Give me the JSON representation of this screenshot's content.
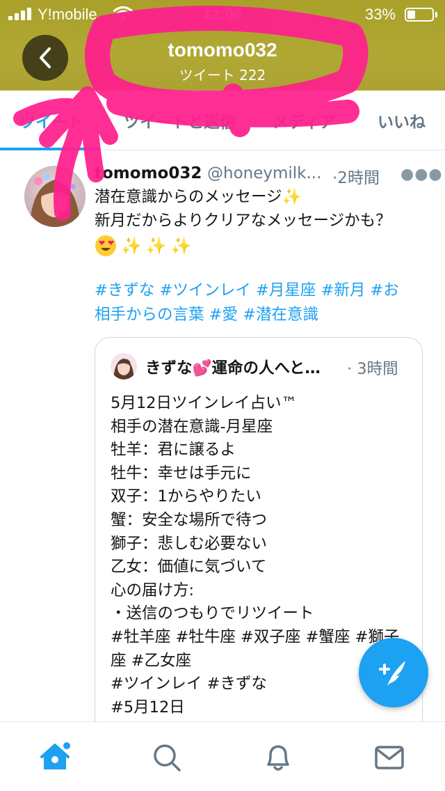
{
  "status_bar": {
    "carrier": "Y!mobile",
    "time": "12:06",
    "battery_percent": "33%",
    "battery_level": 0.33
  },
  "header": {
    "back_icon": "chevron-left-icon",
    "name": "tomomo032",
    "subtitle": "ツイート 222"
  },
  "tabs": [
    {
      "label": "ツイート",
      "active": true
    },
    {
      "label": "ツイートと返信",
      "active": false
    },
    {
      "label": "メディア",
      "active": false
    },
    {
      "label": "いいね",
      "active": false
    }
  ],
  "tweet": {
    "author_name": "tomomo032",
    "author_handle": "@honeymilk...",
    "time": "·2時間",
    "more_icon": "more-horizontal-icon",
    "text_lines": [
      "潜在意識からのメッセージ✨",
      "新月だからよりクリアなメッセージかも？"
    ],
    "emojis": [
      "😍",
      "✨",
      "✨",
      "✨"
    ],
    "hashtag_lines": [
      "#きずな #ツインレイ #月星座 #新月  #お",
      "相手からの言葉 #愛 #潜在意識"
    ]
  },
  "quoted_tweet": {
    "author_name": "きずな💕運命の人へと…",
    "time": "· 3時間",
    "lines": [
      "5月12日ツインレイ占い™",
      "相手の潜在意識-月星座",
      "牡羊：君に譲るよ",
      "牡牛：幸せは手元に",
      "双子：1からやりたい",
      "蟹：安全な場所で待つ",
      "獅子：悲しむ必要ない",
      "乙女：価値に気づいて",
      "心の届け方:",
      "・送信のつもりでリツイート",
      "#牡羊座 #牡牛座 #双子座 #蟹座 #獅子",
      "座 #乙女座",
      "#ツインレイ #きずな",
      "#5月12日"
    ]
  },
  "fab": {
    "icon": "compose-tweet-icon"
  },
  "bottom_nav": [
    {
      "icon": "home-icon",
      "active": true,
      "has_notification_dot": true
    },
    {
      "icon": "search-icon",
      "active": false
    },
    {
      "icon": "notifications-bell-icon",
      "active": false
    },
    {
      "icon": "messages-envelope-icon",
      "active": false
    }
  ],
  "colors": {
    "header_bg": "#aea531",
    "accent": "#1da1f2",
    "text_primary": "#14171a",
    "text_secondary": "#657786",
    "scribble": "#ff1f8e"
  }
}
